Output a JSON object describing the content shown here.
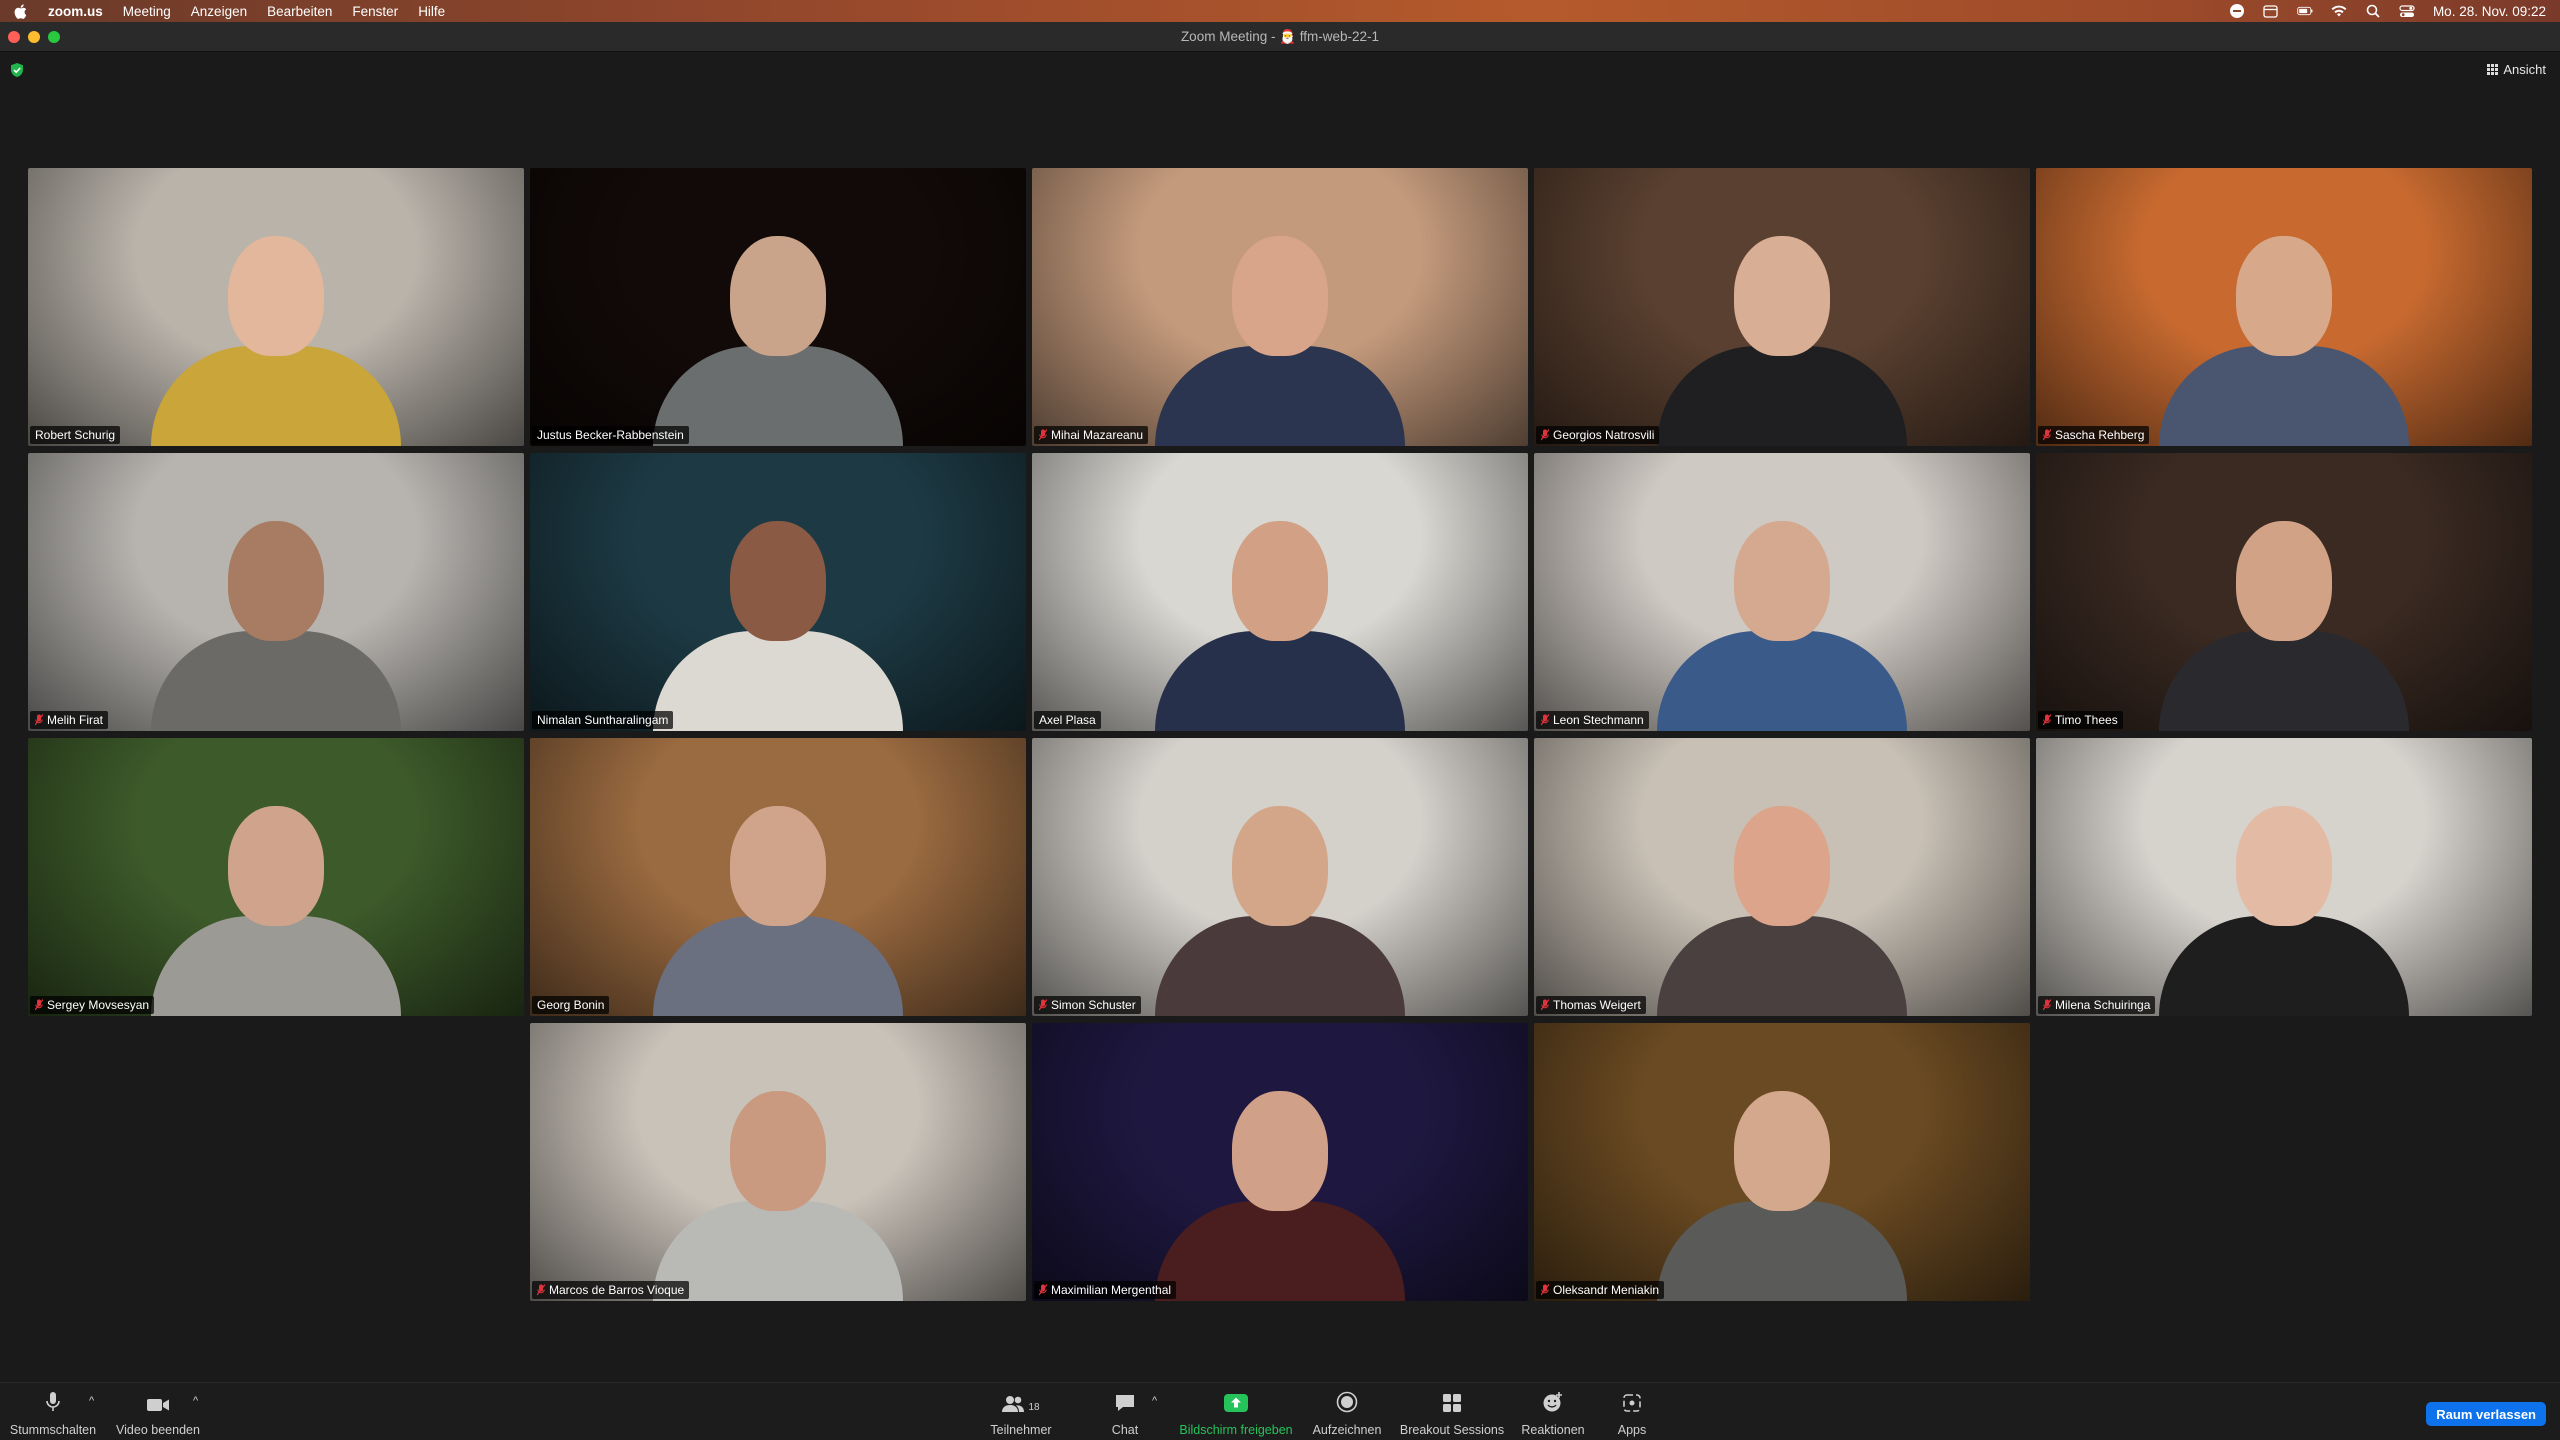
{
  "menubar": {
    "app_name": "zoom.us",
    "items": [
      "Meeting",
      "Anzeigen",
      "Bearbeiten",
      "Fenster",
      "Hilfe"
    ],
    "clock": "Mo. 28. Nov. 09:22"
  },
  "window": {
    "title": "Zoom Meeting - 🎅 ffm-web-22-1"
  },
  "topbar": {
    "view_label": "Ansicht"
  },
  "participants": [
    {
      "name": "Robert Schurig",
      "muted": false,
      "bg": "#b9b3aa",
      "shirt": "#c9a53a",
      "skin": "#e2b79b"
    },
    {
      "name": "Justus Becker-Rabbenstein",
      "muted": false,
      "bg": "#120a08",
      "shirt": "#6a6e6e",
      "skin": "#c9a48a"
    },
    {
      "name": "Mihai Mazareanu",
      "muted": true,
      "bg": "#c49a7c",
      "shirt": "#2c3550",
      "skin": "#d9a58a"
    },
    {
      "name": "Georgios Natrosvili",
      "muted": true,
      "bg": "#5a4030",
      "shirt": "#1f1f22",
      "skin": "#d8ae95"
    },
    {
      "name": "Sascha Rehberg",
      "muted": true,
      "bg": "#c86a30",
      "shirt": "#4a5570",
      "skin": "#d7a88a"
    },
    {
      "name": "Melih Firat",
      "muted": true,
      "bg": "#b7b4b0",
      "shirt": "#6c6a66",
      "skin": "#a87c62"
    },
    {
      "name": "Nimalan Suntharalingam",
      "muted": false,
      "bg": "#1d3a44",
      "shirt": "#dcd8d2",
      "skin": "#8a5a44"
    },
    {
      "name": "Axel Plasa",
      "muted": false,
      "bg": "#d9d7d2",
      "shirt": "#26304a",
      "skin": "#d1a085"
    },
    {
      "name": "Leon Stechmann",
      "muted": true,
      "bg": "#cfc9c3",
      "shirt": "#3a5a8a",
      "skin": "#d5a98f"
    },
    {
      "name": "Timo Thees",
      "muted": true,
      "bg": "#3a2a22",
      "shirt": "#2a2a2e",
      "skin": "#d2a286"
    },
    {
      "name": "Sergey Movsesyan",
      "muted": true,
      "bg": "#3d5a2a",
      "shirt": "#9c9a94",
      "skin": "#d0a48c"
    },
    {
      "name": "Georg Bonin",
      "muted": false,
      "bg": "#9a6a40",
      "shirt": "#6a7080",
      "skin": "#d0a48a"
    },
    {
      "name": "Simon Schuster",
      "muted": true,
      "bg": "#d4d0ca",
      "shirt": "#4a3a3c",
      "skin": "#d3a68a"
    },
    {
      "name": "Thomas Weigert",
      "muted": true,
      "bg": "#c8c0b5",
      "shirt": "#4a4040",
      "skin": "#dca48a"
    },
    {
      "name": "Milena Schuiringa",
      "muted": true,
      "bg": "#d6d2cc",
      "shirt": "#1e1e1e",
      "skin": "#e3bba5"
    },
    {
      "name": "Marcos de Barros Vioque",
      "muted": true,
      "bg": "#c9c2b9",
      "shirt": "#b9b9b6",
      "skin": "#c99a80"
    },
    {
      "name": "Maximilian Mergenthal",
      "muted": true,
      "bg": "#1e1840",
      "shirt": "#4a1e1e",
      "skin": "#d0a088"
    },
    {
      "name": "Oleksandr Meniakin",
      "muted": true,
      "bg": "#6a4a22",
      "shirt": "#5a5a58",
      "skin": "#d3a88c"
    }
  ],
  "active_speaker": "Axel Plasa",
  "toolbar": {
    "mute_label": "Stummschalten",
    "video_label": "Video beenden",
    "participants_label": "Teilnehmer",
    "participants_count": "18",
    "chat_label": "Chat",
    "share_label": "Bildschirm freigeben",
    "record_label": "Aufzeichnen",
    "breakout_label": "Breakout Sessions",
    "reactions_label": "Reaktionen",
    "apps_label": "Apps",
    "leave_label": "Raum verlassen"
  },
  "colors": {
    "accent_blue": "#0e72ed",
    "share_green": "#26c25a",
    "speaker_outline": "#23c552",
    "muted_red": "#e0343c"
  }
}
